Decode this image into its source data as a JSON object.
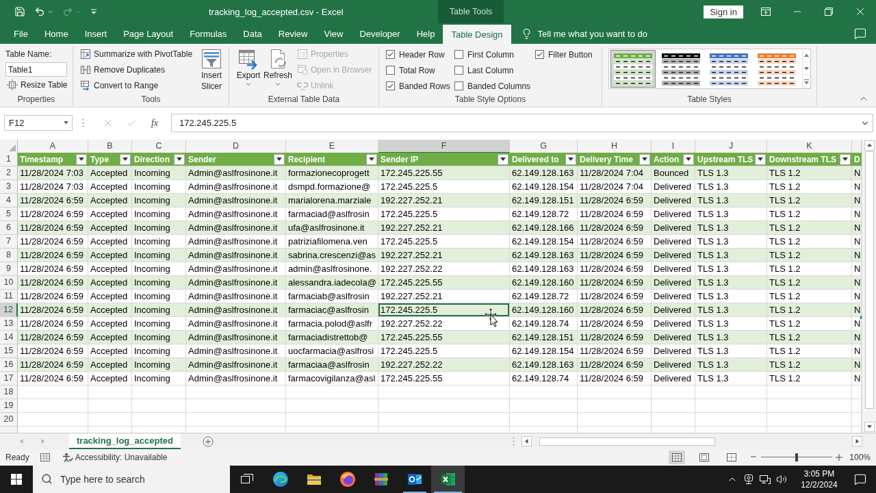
{
  "title_bar": {
    "title": "tracking_log_accepted.csv - Excel",
    "context_tab": "Table Tools",
    "sign_in": "Sign in"
  },
  "menu_tabs": [
    {
      "label": "File",
      "selected": false
    },
    {
      "label": "Home",
      "selected": false
    },
    {
      "label": "Insert",
      "selected": false
    },
    {
      "label": "Page Layout",
      "selected": false
    },
    {
      "label": "Formulas",
      "selected": false
    },
    {
      "label": "Data",
      "selected": false
    },
    {
      "label": "Review",
      "selected": false
    },
    {
      "label": "View",
      "selected": false
    },
    {
      "label": "Developer",
      "selected": false
    },
    {
      "label": "Help",
      "selected": false
    },
    {
      "label": "Table Design",
      "selected": true
    }
  ],
  "tell_me": {
    "placeholder": "Tell me what you want to do"
  },
  "ribbon": {
    "properties": {
      "label": "Properties",
      "table_name_label": "Table Name:",
      "table_name": "Table1",
      "resize_button": "Resize Table"
    },
    "tools": {
      "label": "Tools",
      "commands": [
        "Summarize with PivotTable",
        "Remove Duplicates",
        "Convert to Range"
      ],
      "slicer_button": "Insert Slicer"
    },
    "external_data": {
      "label": "External Table Data",
      "large_buttons": [
        "Export",
        "Refresh"
      ],
      "small_buttons": [
        {
          "label": "Properties",
          "disabled": true
        },
        {
          "label": "Open in Browser",
          "disabled": true
        },
        {
          "label": "Unlink",
          "disabled": true
        }
      ]
    },
    "style_options": {
      "label": "Table Style Options",
      "options": [
        {
          "label": "Header Row",
          "checked": true
        },
        {
          "label": "Total Row",
          "checked": false
        },
        {
          "label": "Banded Rows",
          "checked": true
        },
        {
          "label": "First Column",
          "checked": false
        },
        {
          "label": "Last Column",
          "checked": false
        },
        {
          "label": "Banded Columns",
          "checked": false
        },
        {
          "label": "Filter Button",
          "checked": true
        }
      ]
    },
    "table_styles": {
      "label": "Table Styles",
      "styles": [
        {
          "color": "#70ad47",
          "selected": true
        },
        {
          "color": "#000000",
          "selected": false
        },
        {
          "color": "#4472c4",
          "selected": false
        },
        {
          "color": "#ed7d31",
          "selected": false
        }
      ]
    }
  },
  "formula_bar": {
    "name_box": "F12",
    "function_button": "fx",
    "formula": "172.245.225.5"
  },
  "sheet": {
    "columns": [
      {
        "letter": "A",
        "header": "Timestamp",
        "selected": false
      },
      {
        "letter": "B",
        "header": "Type",
        "selected": false
      },
      {
        "letter": "C",
        "header": "Direction",
        "selected": false
      },
      {
        "letter": "D",
        "header": "Sender",
        "selected": false
      },
      {
        "letter": "E",
        "header": "Recipient",
        "selected": false
      },
      {
        "letter": "F",
        "header": "Sender IP",
        "selected": true
      },
      {
        "letter": "G",
        "header": "Delivered to",
        "selected": false
      },
      {
        "letter": "H",
        "header": "Delivery Time",
        "selected": false
      },
      {
        "letter": "I",
        "header": "Action",
        "selected": false
      },
      {
        "letter": "J",
        "header": "Upstream TLS",
        "selected": false
      },
      {
        "letter": "K",
        "header": "Downstream TLS",
        "selected": false
      },
      {
        "header": "D",
        "selected": false
      }
    ],
    "header_row": {
      "number": "1",
      "selected": false
    },
    "rows": [
      {
        "number": "2",
        "selected": false,
        "cells": [
          "11/28/2024 7:03",
          "Accepted",
          "Incoming",
          "Admin@aslfrosinone.it",
          "formazionecoprogett",
          "172.245.225.55",
          "62.149.128.163",
          "11/28/2024 7:04",
          "Bounced",
          "TLS 1.3",
          "TLS 1.2",
          "N"
        ]
      },
      {
        "number": "3",
        "selected": false,
        "cells": [
          "11/28/2024 7:03",
          "Accepted",
          "Incoming",
          "Admin@aslfrosinone.it",
          "dsmpd.formazione@",
          "172.245.225.5",
          "62.149.128.154",
          "11/28/2024 7:04",
          "Delivered",
          "TLS 1.3",
          "TLS 1.2",
          "N"
        ]
      },
      {
        "number": "4",
        "selected": false,
        "cells": [
          "11/28/2024 6:59",
          "Accepted",
          "Incoming",
          "Admin@aslfrosinone.it",
          "marialorena.marziale",
          "192.227.252.21",
          "62.149.128.151",
          "11/28/2024 6:59",
          "Delivered",
          "TLS 1.3",
          "TLS 1.2",
          "N"
        ]
      },
      {
        "number": "5",
        "selected": false,
        "cells": [
          "11/28/2024 6:59",
          "Accepted",
          "Incoming",
          "Admin@aslfrosinone.it",
          "farmaciad@aslfrosin",
          "172.245.225.5",
          "62.149.128.72",
          "11/28/2024 6:59",
          "Delivered",
          "TLS 1.3",
          "TLS 1.2",
          "N"
        ]
      },
      {
        "number": "6",
        "selected": false,
        "cells": [
          "11/28/2024 6:59",
          "Accepted",
          "Incoming",
          "Admin@aslfrosinone.it",
          "ufa@aslfrosinone.it",
          "192.227.252.21",
          "62.149.128.166",
          "11/28/2024 6:59",
          "Delivered",
          "TLS 1.3",
          "TLS 1.2",
          "N"
        ]
      },
      {
        "number": "7",
        "selected": false,
        "cells": [
          "11/28/2024 6:59",
          "Accepted",
          "Incoming",
          "Admin@aslfrosinone.it",
          "patriziafilomena.ven",
          "172.245.225.5",
          "62.149.128.154",
          "11/28/2024 6:59",
          "Delivered",
          "TLS 1.3",
          "TLS 1.2",
          "N"
        ]
      },
      {
        "number": "8",
        "selected": false,
        "cells": [
          "11/28/2024 6:59",
          "Accepted",
          "Incoming",
          "Admin@aslfrosinone.it",
          "sabrina.crescenzi@as",
          "192.227.252.21",
          "62.149.128.163",
          "11/28/2024 6:59",
          "Delivered",
          "TLS 1.3",
          "TLS 1.2",
          "N"
        ]
      },
      {
        "number": "9",
        "selected": false,
        "cells": [
          "11/28/2024 6:59",
          "Accepted",
          "Incoming",
          "Admin@aslfrosinone.it",
          "admin@aslfrosinone.",
          "192.227.252.22",
          "62.149.128.163",
          "11/28/2024 6:59",
          "Delivered",
          "TLS 1.3",
          "TLS 1.2",
          "N"
        ]
      },
      {
        "number": "10",
        "selected": false,
        "cells": [
          "11/28/2024 6:59",
          "Accepted",
          "Incoming",
          "Admin@aslfrosinone.it",
          "alessandra.iadecola@",
          "172.245.225.55",
          "62.149.128.160",
          "11/28/2024 6:59",
          "Delivered",
          "TLS 1.3",
          "TLS 1.2",
          "N"
        ]
      },
      {
        "number": "11",
        "selected": false,
        "cells": [
          "11/28/2024 6:59",
          "Accepted",
          "Incoming",
          "Admin@aslfrosinone.it",
          "farmaciab@aslfrosin",
          "192.227.252.21",
          "62.149.128.72",
          "11/28/2024 6:59",
          "Delivered",
          "TLS 1.3",
          "TLS 1.2",
          "N"
        ]
      },
      {
        "number": "12",
        "selected": true,
        "cells": [
          "11/28/2024 6:59",
          "Accepted",
          "Incoming",
          "Admin@aslfrosinone.it",
          "farmaciac@aslfrosin",
          "172.245.225.5",
          "62.149.128.160",
          "11/28/2024 6:59",
          "Delivered",
          "TLS 1.3",
          "TLS 1.2",
          "N"
        ]
      },
      {
        "number": "13",
        "selected": false,
        "cells": [
          "11/28/2024 6:59",
          "Accepted",
          "Incoming",
          "Admin@aslfrosinone.it",
          "farmacia.polod@aslfr",
          "192.227.252.22",
          "62.149.128.74",
          "11/28/2024 6:59",
          "Delivered",
          "TLS 1.3",
          "TLS 1.2",
          "N"
        ]
      },
      {
        "number": "14",
        "selected": false,
        "cells": [
          "11/28/2024 6:59",
          "Accepted",
          "Incoming",
          "Admin@aslfrosinone.it",
          "farmaciadistrettob@",
          "172.245.225.55",
          "62.149.128.151",
          "11/28/2024 6:59",
          "Delivered",
          "TLS 1.3",
          "TLS 1.2",
          "N"
        ]
      },
      {
        "number": "15",
        "selected": false,
        "cells": [
          "11/28/2024 6:59",
          "Accepted",
          "Incoming",
          "Admin@aslfrosinone.it",
          "uocfarmacia@aslfrosi",
          "172.245.225.5",
          "62.149.128.154",
          "11/28/2024 6:59",
          "Delivered",
          "TLS 1.3",
          "TLS 1.2",
          "N"
        ]
      },
      {
        "number": "16",
        "selected": false,
        "cells": [
          "11/28/2024 6:59",
          "Accepted",
          "Incoming",
          "Admin@aslfrosinone.it",
          "farmaciaa@aslfrosin",
          "192.227.252.22",
          "62.149.128.163",
          "11/28/2024 6:59",
          "Delivered",
          "TLS 1.3",
          "TLS 1.2",
          "N"
        ]
      },
      {
        "number": "17",
        "selected": false,
        "cells": [
          "11/28/2024 6:59",
          "Accepted",
          "Incoming",
          "Admin@aslfrosinone.it",
          "farmacovigilanza@asl",
          "172.245.225.55",
          "62.149.128.74",
          "11/28/2024 6:59",
          "Delivered",
          "TLS 1.3",
          "TLS 1.2",
          "N"
        ]
      }
    ],
    "empty_rows": [
      {
        "number": "18",
        "selected": false
      },
      {
        "number": "19",
        "selected": false
      },
      {
        "number": "20",
        "selected": false
      }
    ]
  },
  "sheet_tabs": [
    {
      "name": "tracking_log_accepted",
      "selected": true
    }
  ],
  "status_bar": {
    "mode": "Ready",
    "accessibility": "Accessibility: Unavailable",
    "views": [
      {
        "selected": true
      },
      {
        "selected": false
      },
      {
        "selected": false
      }
    ],
    "zoom": {
      "level": 0.5,
      "label": "100%"
    }
  },
  "taskbar": {
    "search_placeholder": "Type here to search",
    "apps": [
      {
        "running": false,
        "selected": false
      },
      {
        "running": false,
        "selected": false
      },
      {
        "running": false,
        "selected": false
      },
      {
        "running": false,
        "selected": false
      },
      {
        "running": true,
        "selected": false
      },
      {
        "running": true,
        "selected": true
      }
    ],
    "time": "3:05 PM",
    "date": "12/2/2024"
  }
}
